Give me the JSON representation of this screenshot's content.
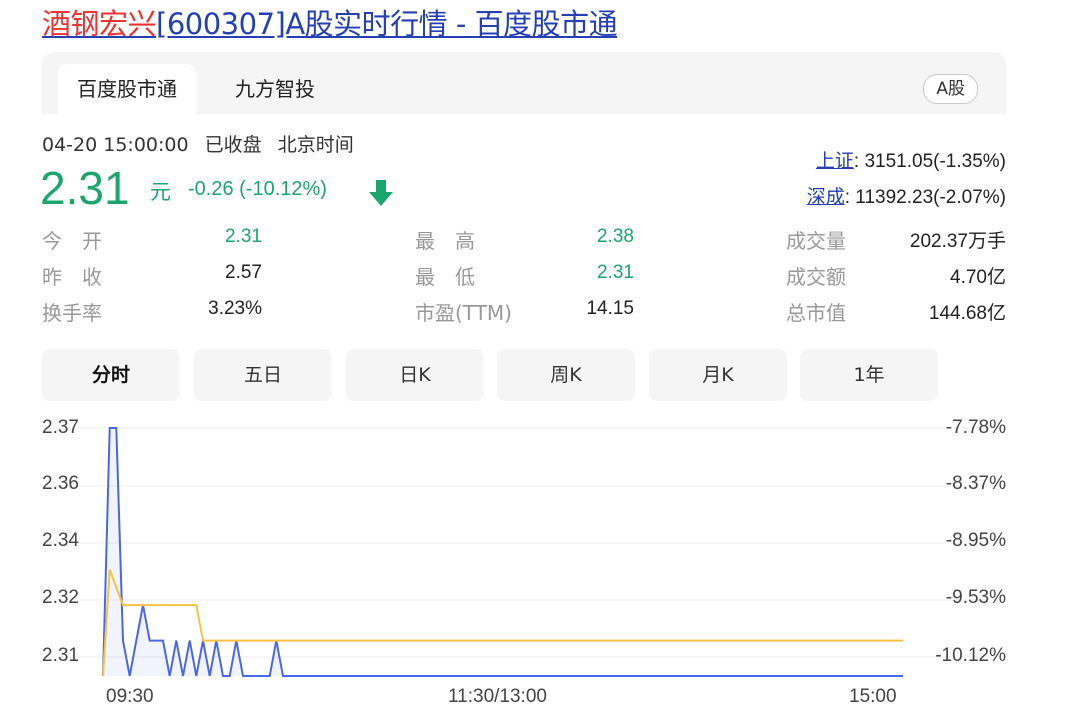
{
  "page_title": {
    "highlight": "酒钢宏兴",
    "rest": "[600307]A股实时行情 - 百度股市通"
  },
  "source_tabs": [
    {
      "label": "百度股市通",
      "active": true
    },
    {
      "label": "九方智投",
      "active": false
    }
  ],
  "market_badge": "A股",
  "quote": {
    "datetime": "04-20 15:00:00",
    "status": "已收盘",
    "timezone": "北京时间",
    "price": "2.31",
    "unit": "元",
    "change": "-0.26 (-10.12%)",
    "direction": "down",
    "colors": {
      "down": "#1aa66c",
      "up": "#e33"
    }
  },
  "indices": [
    {
      "name": "上证",
      "value": ": 3151.05(-1.35%)"
    },
    {
      "name": "深成",
      "value": ": 11392.23(-2.07%)"
    }
  ],
  "stats": [
    {
      "label": "今　开",
      "value": "2.31",
      "tone": "green"
    },
    {
      "label": "最　高",
      "value": "2.38",
      "tone": "green"
    },
    {
      "label": "成交量",
      "value": "202.37万手",
      "tone": "dark"
    },
    {
      "label": "昨　收",
      "value": "2.57",
      "tone": "dark"
    },
    {
      "label": "最　低",
      "value": "2.31",
      "tone": "green"
    },
    {
      "label": "成交额",
      "value": "4.70亿",
      "tone": "dark"
    },
    {
      "label": "换手率",
      "value": "3.23%",
      "tone": "dark"
    },
    {
      "label": "市盈(TTM)",
      "value": "14.15",
      "tone": "dark"
    },
    {
      "label": "总市值",
      "value": "144.68亿",
      "tone": "dark"
    }
  ],
  "period_tabs": [
    {
      "label": "分时",
      "active": true
    },
    {
      "label": "五日",
      "active": false
    },
    {
      "label": "日K",
      "active": false
    },
    {
      "label": "周K",
      "active": false
    },
    {
      "label": "月K",
      "active": false
    },
    {
      "label": "1年",
      "active": false
    }
  ],
  "chart_data": {
    "type": "line",
    "y_ticks": [
      "2.37",
      "2.36",
      "2.34",
      "2.32",
      "2.31"
    ],
    "y_right_ticks": [
      "-7.78%",
      "-8.37%",
      "-8.95%",
      "-9.53%",
      "-10.12%"
    ],
    "x_ticks": [
      "09:30",
      "11:30/13:00",
      "15:00"
    ],
    "ylim": [
      2.3,
      2.37
    ],
    "grid": true,
    "series": [
      {
        "color": "#4a67e8",
        "values": [
          2.3,
          2.37,
          2.37,
          2.31,
          2.3,
          2.31,
          2.32,
          2.31,
          2.31,
          2.31,
          2.3,
          2.31,
          2.3,
          2.31,
          2.3,
          2.31,
          2.3,
          2.31,
          2.3,
          2.3,
          2.31,
          2.3,
          2.3,
          2.3,
          2.3,
          2.3,
          2.31,
          2.3,
          2.3,
          2.3,
          2.3,
          2.3,
          2.3,
          2.3,
          2.3,
          2.3,
          2.3,
          2.3,
          2.3,
          2.3,
          2.3,
          2.3,
          2.3,
          2.3,
          2.3,
          2.3,
          2.3,
          2.3,
          2.3,
          2.3,
          2.3,
          2.3,
          2.3,
          2.3,
          2.3,
          2.3,
          2.3,
          2.3,
          2.3,
          2.3,
          2.3,
          2.3,
          2.3,
          2.3,
          2.3,
          2.3,
          2.3,
          2.3,
          2.3,
          2.3,
          2.3,
          2.3,
          2.3,
          2.3,
          2.3,
          2.3,
          2.3,
          2.3,
          2.3,
          2.3,
          2.3,
          2.3,
          2.3,
          2.3,
          2.3,
          2.3,
          2.3,
          2.3,
          2.3,
          2.3,
          2.3,
          2.3,
          2.3,
          2.3,
          2.3,
          2.3,
          2.3,
          2.3,
          2.3,
          2.3,
          2.3,
          2.3,
          2.3,
          2.3,
          2.3,
          2.3,
          2.3,
          2.3,
          2.3,
          2.3,
          2.3,
          2.3,
          2.3,
          2.3,
          2.3,
          2.3,
          2.3,
          2.3,
          2.3,
          2.3,
          2.3
        ]
      },
      {
        "color": "#f5c242",
        "values": [
          2.3,
          2.33,
          2.325,
          2.32,
          2.32,
          2.32,
          2.32,
          2.32,
          2.32,
          2.32,
          2.32,
          2.32,
          2.32,
          2.32,
          2.32,
          2.31,
          2.31,
          2.31,
          2.31,
          2.31,
          2.31,
          2.31,
          2.31,
          2.31,
          2.31,
          2.31,
          2.31,
          2.31,
          2.31,
          2.31,
          2.31,
          2.31,
          2.31,
          2.31,
          2.31,
          2.31,
          2.31,
          2.31,
          2.31,
          2.31,
          2.31,
          2.31,
          2.31,
          2.31,
          2.31,
          2.31,
          2.31,
          2.31,
          2.31,
          2.31,
          2.31,
          2.31,
          2.31,
          2.31,
          2.31,
          2.31,
          2.31,
          2.31,
          2.31,
          2.31,
          2.31,
          2.31,
          2.31,
          2.31,
          2.31,
          2.31,
          2.31,
          2.31,
          2.31,
          2.31,
          2.31,
          2.31,
          2.31,
          2.31,
          2.31,
          2.31,
          2.31,
          2.31,
          2.31,
          2.31,
          2.31,
          2.31,
          2.31,
          2.31,
          2.31,
          2.31,
          2.31,
          2.31,
          2.31,
          2.31,
          2.31,
          2.31,
          2.31,
          2.31,
          2.31,
          2.31,
          2.31,
          2.31,
          2.31,
          2.31,
          2.31,
          2.31,
          2.31,
          2.31,
          2.31,
          2.31,
          2.31,
          2.31,
          2.31,
          2.31,
          2.31,
          2.31,
          2.31,
          2.31,
          2.31,
          2.31,
          2.31,
          2.31,
          2.31,
          2.31,
          2.31
        ]
      }
    ]
  }
}
